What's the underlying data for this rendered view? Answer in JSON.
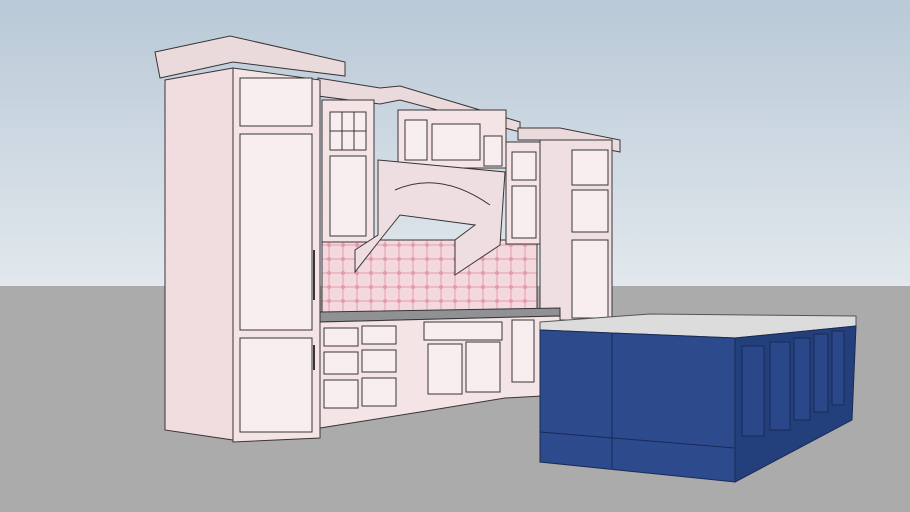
{
  "scene": {
    "description_label": "",
    "colors": {
      "sky_top": "#b9c9d7",
      "sky_bottom": "#e2e8ed",
      "ground": "#ababab",
      "cabinet": "#f4e4e6",
      "cabinet_shade": "#e6d2d5",
      "backsplash": "#f0cfd6",
      "counter": "#8f9192",
      "island_front": "#2c4a8c",
      "island_side": "#24407c",
      "island_top": "#dcdcdc",
      "line": "#3a3535"
    }
  }
}
